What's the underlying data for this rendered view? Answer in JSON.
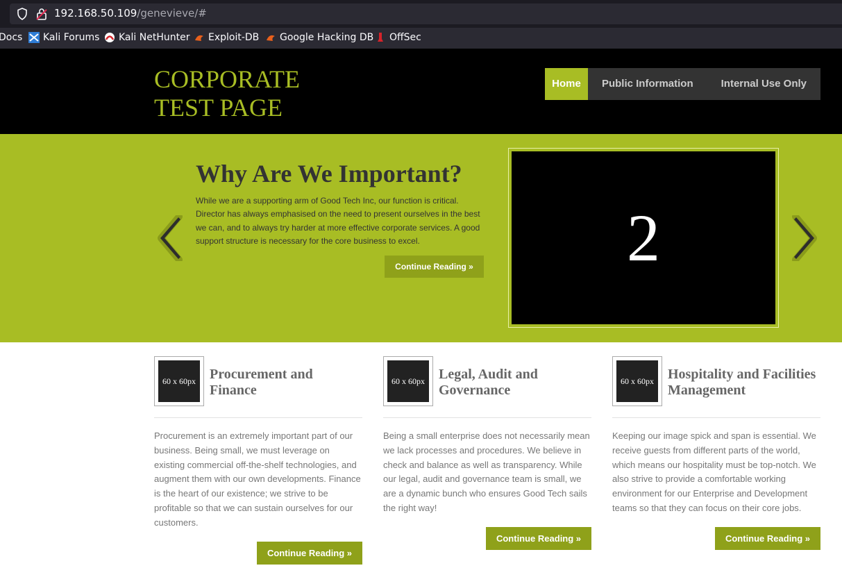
{
  "browser": {
    "url_host": "192.168.50.109",
    "url_path": "/genevieve/#",
    "bookmarks": [
      {
        "label": "Docs",
        "icon": "docs-icon"
      },
      {
        "label": "Kali Forums",
        "icon": "kali-forums-icon"
      },
      {
        "label": "Kali NetHunter",
        "icon": "kali-nethunter-icon"
      },
      {
        "label": "Exploit-DB",
        "icon": "exploit-db-icon"
      },
      {
        "label": "Google Hacking DB",
        "icon": "google-hacking-db-icon"
      },
      {
        "label": "OffSec",
        "icon": "offsec-icon"
      }
    ]
  },
  "site": {
    "logo_line1": "CORPORATE",
    "logo_line2": "TEST PAGE",
    "nav": [
      {
        "label": "Home",
        "active": true
      },
      {
        "label": "Public Information",
        "active": false
      },
      {
        "label": "Internal Use Only",
        "active": false
      }
    ]
  },
  "hero": {
    "title": "Why Are We Important?",
    "text": "While we are a supporting arm of Good Tech Inc, our function is critical. Director has always emphasised on the need to present ourselves in the best we can, and to always try harder at more effective corporate services. A good support structure is necessary for the core business to excel.",
    "button": "Continue Reading »",
    "slide_number": "2"
  },
  "columns": [
    {
      "thumb": "60 x 60px",
      "title": "Procurement and Finance",
      "text": "Procurement is an extremely important part of our business. Being small, we must leverage on existing commercial off-the-shelf technologies, and augment them with our own developments. Finance is the heart of our existence; we strive to be profitable so that we can sustain ourselves for our customers.",
      "button": "Continue Reading »"
    },
    {
      "thumb": "60 x 60px",
      "title": "Legal, Audit and Governance",
      "text": "Being a small enterprise does not necessarily mean we lack processes and procedures. We believe in check and balance as well as transparency. While our legal, audit and governance team is small, we are a dynamic bunch who ensures Good Tech sails the right way!",
      "button": "Continue Reading »"
    },
    {
      "thumb": "60 x 60px",
      "title": "Hospitality and Facilities Management",
      "text": "Keeping our image spick and span is essential. We receive guests from different parts of the world, which means our hospitality must be top-notch. We also strive to provide a comfortable working environment for our Enterprise and Development teams so that they can focus on their core jobs.",
      "button": "Continue Reading »"
    }
  ],
  "colors": {
    "accent": "#a8bd24",
    "button": "#8fa11a",
    "header_bg": "#000000",
    "nav_bg": "#333333"
  }
}
